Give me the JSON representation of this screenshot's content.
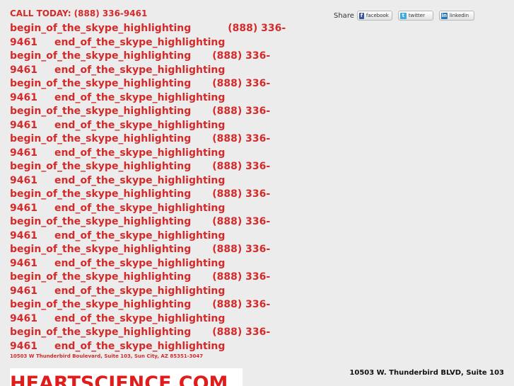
{
  "header": {
    "call_today": "CALL TODAY: (888) 336-9461"
  },
  "skype": {
    "first_line": {
      "begin": "begin_of_the_skype_highlighting",
      "phone": "(888) 336-"
    },
    "repeat_line_a": {
      "prefix": "9461",
      "end": "end_of_the_skype_highlighting"
    },
    "repeat_line_b": {
      "begin": "begin_of_the_skype_highlighting",
      "phone": "(888) 336-"
    }
  },
  "address_small": "10503 W Thunderbird Boulevard, Suite 103, Sun City, AZ 85351-3047",
  "share": {
    "label": "Share",
    "facebook": "facebook",
    "twitter": "twitter",
    "linkedin": "linkedin"
  },
  "logo": {
    "text": "HEARTSCIENCE.COM"
  },
  "address_right": "10503 W. Thunderbird BLVD, Suite 103",
  "colors": {
    "red": "#d42a2a",
    "background": "#ececec"
  }
}
